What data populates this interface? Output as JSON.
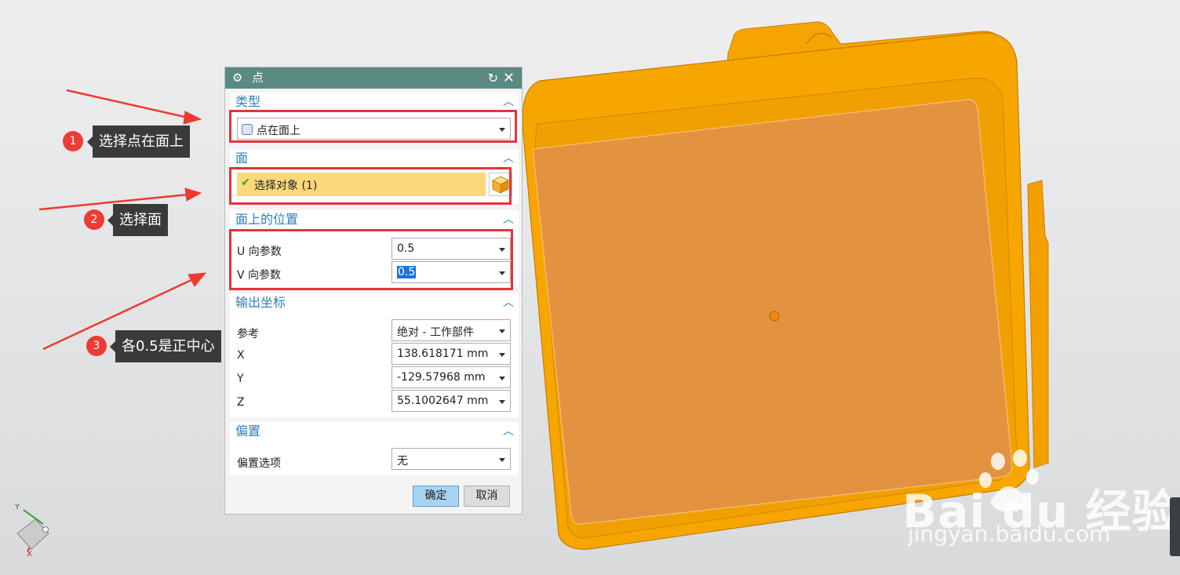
{
  "dialog": {
    "title": "点",
    "type_group": {
      "header": "类型",
      "selected": "点在面上"
    },
    "face_group": {
      "header": "面",
      "select_label": "选择对象 (1)"
    },
    "position_group": {
      "header": "面上的位置",
      "u_label": "U 向参数",
      "u_value": "0.5",
      "v_label": "V 向参数",
      "v_value": "0.5"
    },
    "output_group": {
      "header": "输出坐标",
      "ref_label": "参考",
      "ref_value": "绝对 - 工作部件",
      "x_label": "X",
      "x_value": "138.618171 mm",
      "y_label": "Y",
      "y_value": "-129.57968 mm",
      "z_label": "Z",
      "z_value": "55.1002647 mm"
    },
    "offset_group": {
      "header": "偏置",
      "option_label": "偏置选项",
      "option_value": "无"
    },
    "ok_label": "确定",
    "cancel_label": "取消"
  },
  "annotations": [
    {
      "number": "1",
      "text": "选择点在面上"
    },
    {
      "number": "2",
      "text": "选择面"
    },
    {
      "number": "3",
      "text": "各0.5是正中心"
    }
  ],
  "triad": {
    "y": "Y",
    "x": "X"
  },
  "watermark": {
    "brand": "Bai du 经验",
    "url": "jingyan.baidu.com"
  },
  "colors": {
    "part": "#f5a300",
    "face": "#e59440",
    "title_bar": "#5a8a82",
    "highlight": "#e8323c",
    "header_text": "#2e7fb8"
  }
}
